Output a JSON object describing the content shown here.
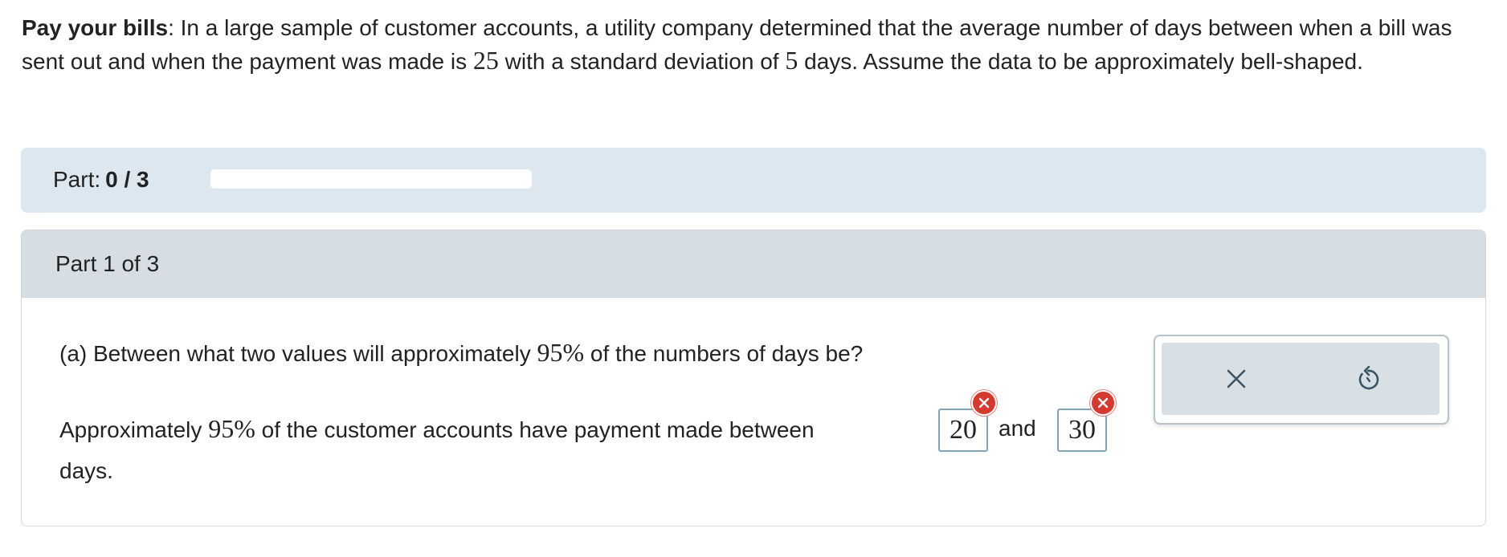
{
  "problem": {
    "title": "Pay your bills",
    "text_part1": ": In a large sample of customer accounts, a utility company determined that the average number of days between when a bill was sent out and when the payment was made is ",
    "mean": "25",
    "text_part2": " with a standard deviation of ",
    "sd": "5",
    "text_part3": " days. Assume the data to be approximately bell-shaped."
  },
  "progress": {
    "label": "Part:",
    "count": "0 / 3",
    "fraction": 0
  },
  "part": {
    "title": "Part 1 of 3",
    "question_prefix": "(a) Between what two values will approximately ",
    "question_percent": "95%",
    "question_suffix": " of the numbers of days be?",
    "answer_prefix": "Approximately ",
    "answer_percent": "95%",
    "answer_middle": " of the customer accounts have payment made between",
    "answer_and": "and",
    "answer_suffix": "days.",
    "answer1_value": "20",
    "answer2_value": "30",
    "error_color": "#d43a2f"
  },
  "tools": {
    "clear_icon": "close-icon",
    "reset_icon": "undo-icon"
  }
}
